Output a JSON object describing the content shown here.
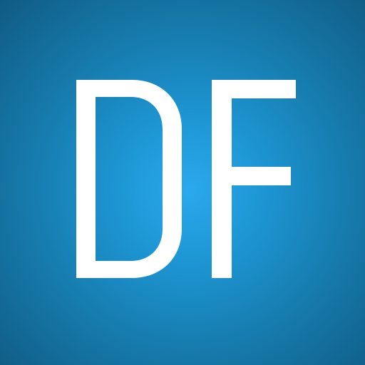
{
  "icon": {
    "logo_text": "DF",
    "foreground_color": "#ffffff",
    "background_colors": [
      "#2aa9ee",
      "#105b84"
    ]
  }
}
